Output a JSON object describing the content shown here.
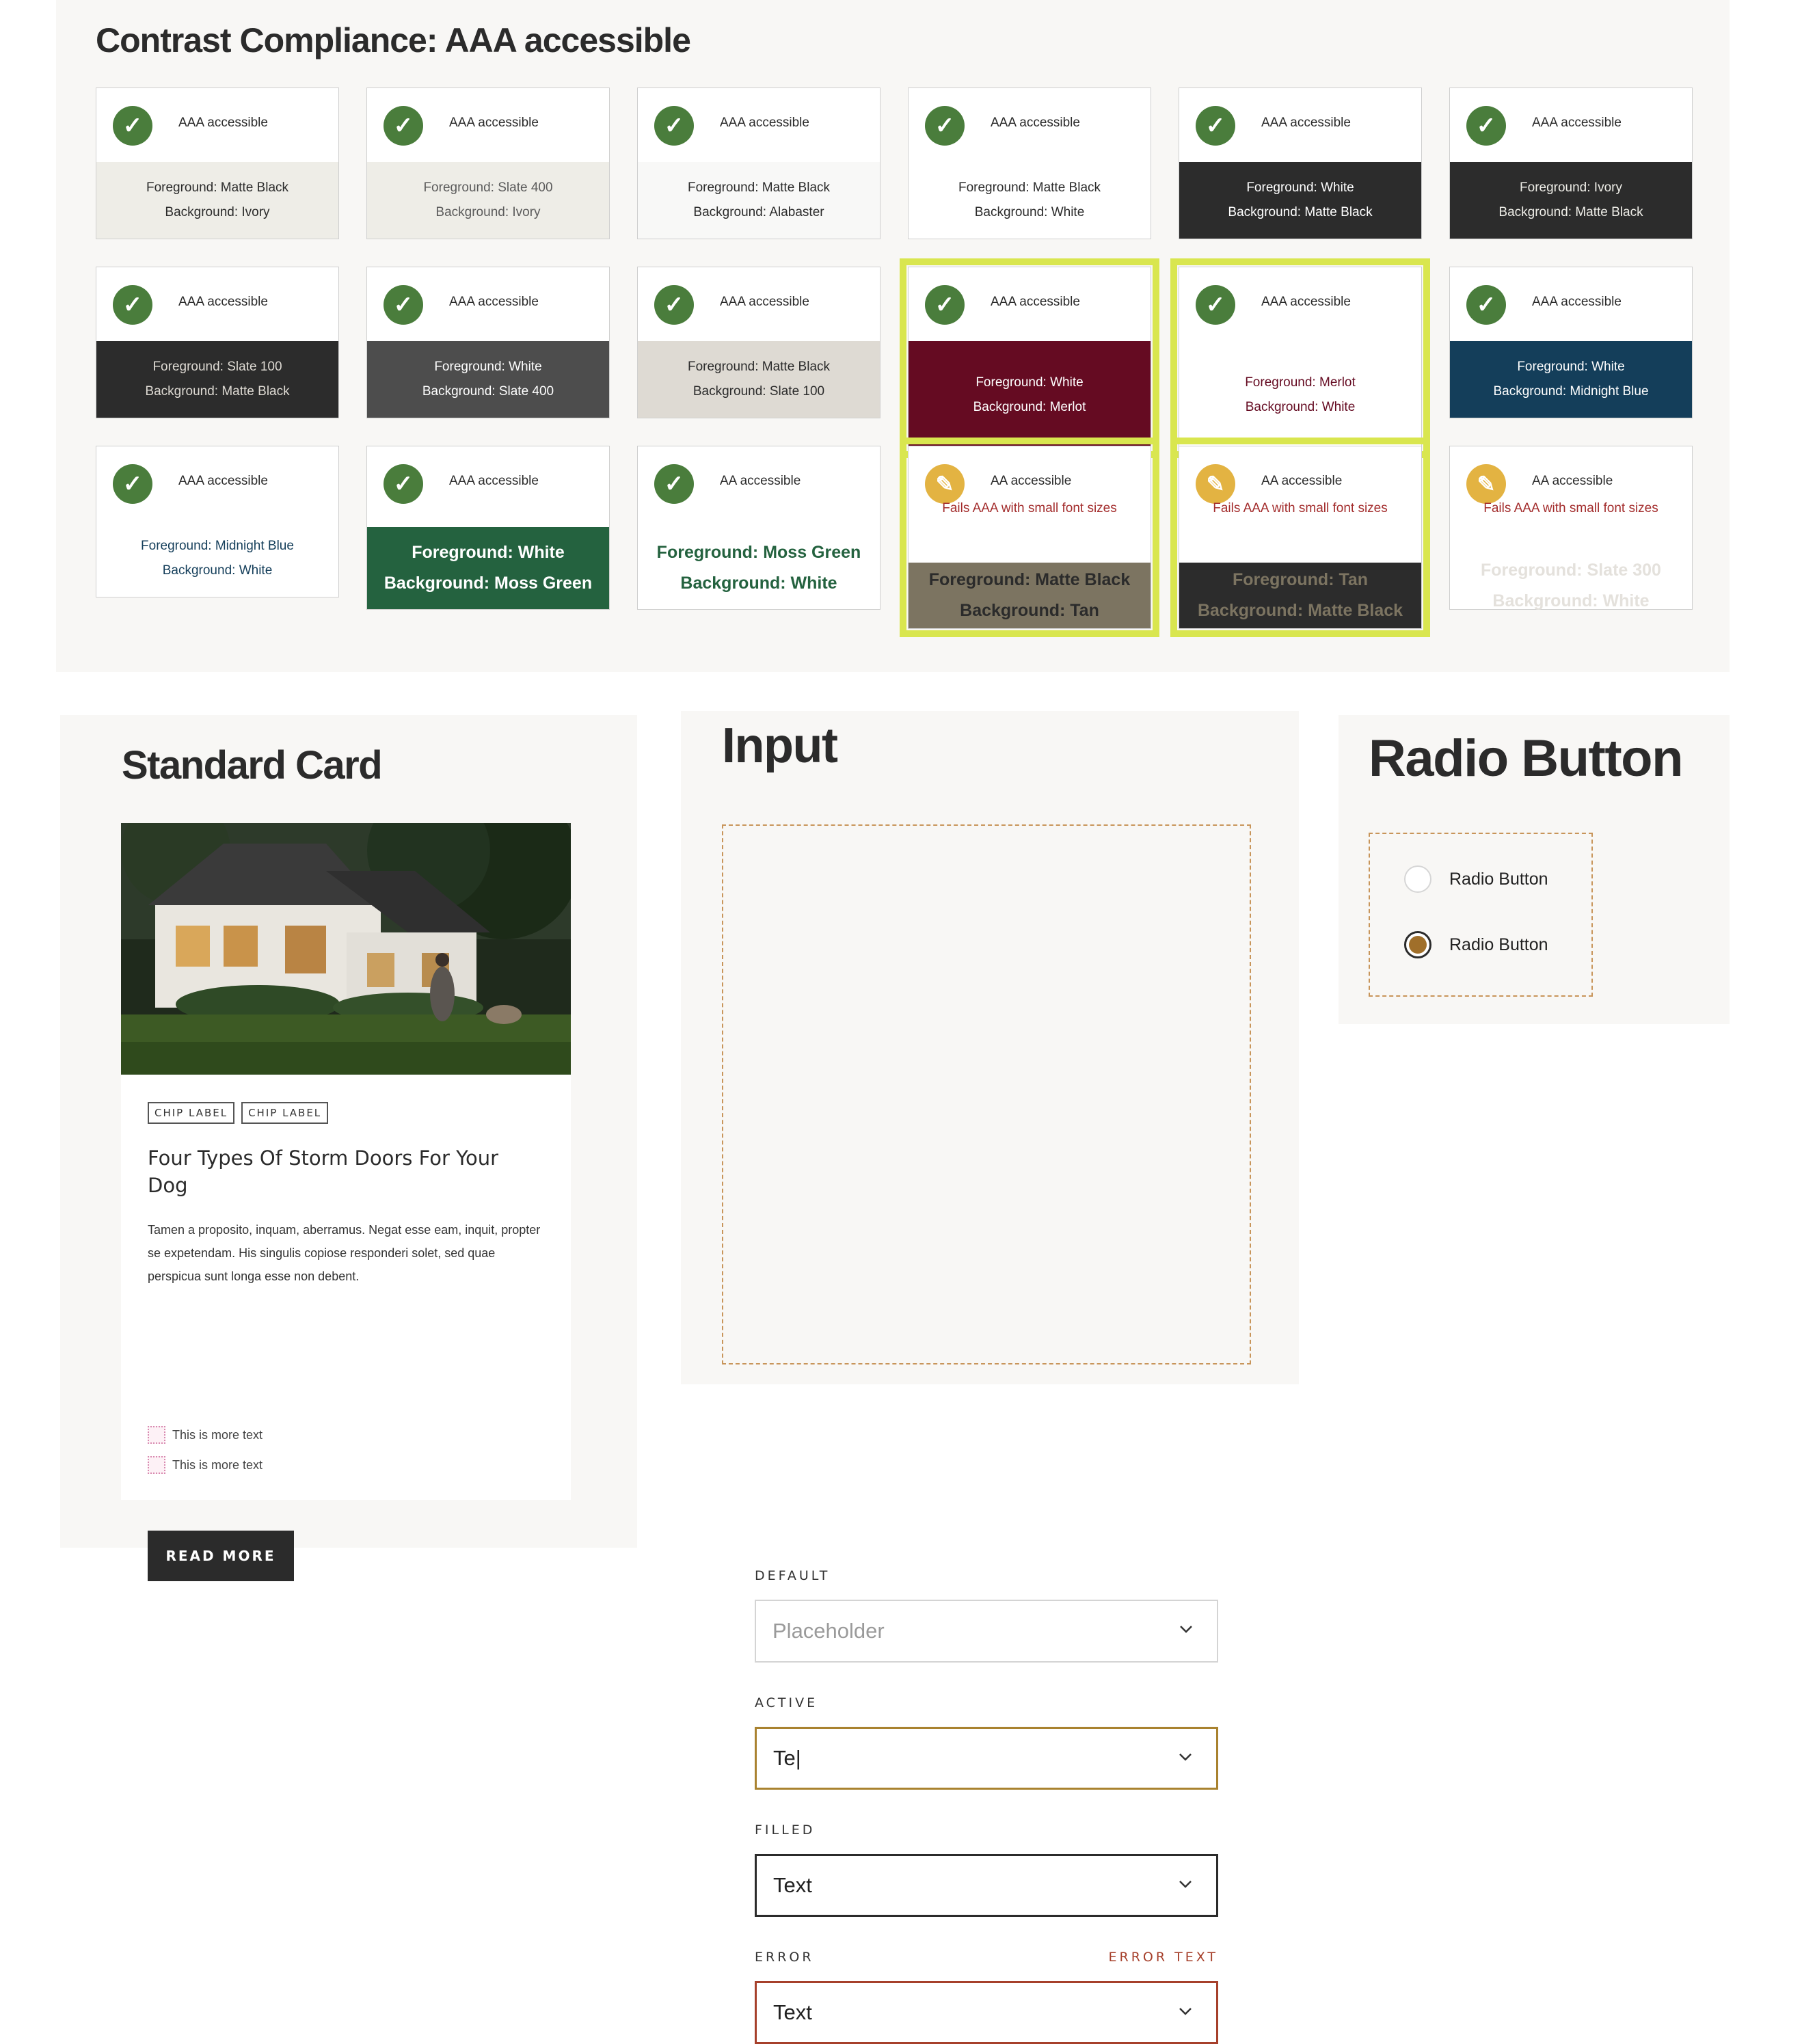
{
  "contrast": {
    "title": "Contrast Compliance: AAA accessible",
    "fails_text": "Fails AAA with small font sizes",
    "cards": [
      {
        "level": "AAA accessible",
        "status": "check-icon",
        "fg": "Foreground: Matte Black",
        "bg": "Background: Ivory",
        "fg_color": "#2b2b2b",
        "bg_color": "#eeede7",
        "strip_color": "#ffffff"
      },
      {
        "level": "AAA accessible",
        "status": "check-icon",
        "fg": "Foreground: Slate 400",
        "bg": "Background: Ivory",
        "fg_color": "#5b5b5b",
        "bg_color": "#eeede7",
        "strip_color": "#ffffff"
      },
      {
        "level": "AAA accessible",
        "status": "check-icon",
        "fg": "Foreground: Matte Black",
        "bg": "Background: Alabaster",
        "fg_color": "#2b2b2b",
        "bg_color": "#f8f8f7",
        "strip_color": "#ffffff"
      },
      {
        "level": "AAA accessible",
        "status": "check-icon",
        "fg": "Foreground: Matte Black",
        "bg": "Background: White",
        "fg_color": "#2b2b2b",
        "bg_color": "#ffffff",
        "strip_color": "#ffffff"
      },
      {
        "level": "AAA accessible",
        "status": "check-icon",
        "fg": "Foreground: White",
        "bg": "Background: Matte Black",
        "fg_color": "#ffffff",
        "bg_color": "#2c2c2c",
        "strip_color": "#ffffff"
      },
      {
        "level": "AAA accessible",
        "status": "check-icon",
        "fg": "Foreground: Ivory",
        "bg": "Background: Matte Black",
        "fg_color": "#eeede7",
        "bg_color": "#2c2c2c",
        "strip_color": "#ffffff"
      },
      {
        "level": "AAA accessible",
        "status": "check-icon",
        "fg": "Foreground: Slate 100",
        "bg": "Background: Matte Black",
        "fg_color": "#dedad3",
        "bg_color": "#2c2c2c",
        "strip_color": "#ffffff"
      },
      {
        "level": "AAA accessible",
        "status": "check-icon",
        "fg": "Foreground: White",
        "bg": "Background: Slate 400",
        "fg_color": "#ffffff",
        "bg_color": "#4d4d4d",
        "strip_color": "#ffffff"
      },
      {
        "level": "AAA accessible",
        "status": "check-icon",
        "fg": "Foreground: Matte Black",
        "bg": "Background: Slate 100",
        "fg_color": "#2b2b2b",
        "bg_color": "#dedad3",
        "strip_color": "#ffffff"
      },
      {
        "level": "AAA accessible",
        "status": "check-icon",
        "fg": "Foreground: White",
        "bg": "Background: Merlot",
        "fg_color": "#ffffff",
        "bg_color": "#650b22",
        "strip_color": "#ffffff",
        "highlight": true
      },
      {
        "level": "AAA accessible",
        "status": "check-icon",
        "fg": "Foreground: Merlot",
        "bg": "Background: White",
        "fg_color": "#650b22",
        "bg_color": "#ffffff",
        "strip_color": "#ffffff",
        "highlight": true
      },
      {
        "level": "AAA accessible",
        "status": "check-icon",
        "fg": "Foreground: White",
        "bg": "Background: Midnight Blue",
        "fg_color": "#ffffff",
        "bg_color": "#143e5a",
        "strip_color": "#ffffff"
      },
      {
        "level": "AAA accessible",
        "status": "check-icon",
        "fg": "Foreground: Midnight Blue",
        "bg": "Background: White",
        "fg_color": "#143e5a",
        "bg_color": "#ffffff",
        "strip_color": "#ffffff"
      },
      {
        "level": "AAA accessible",
        "status": "check-icon",
        "fg": "Foreground: White",
        "bg": "Background: Moss Green",
        "fg_color": "#ffffff",
        "bg_color": "#24623f",
        "strip_color": "#ffffff",
        "large": true
      },
      {
        "level": "AA accessible",
        "status": "check-icon",
        "fg": "Foreground: Moss Green",
        "bg": "Background: White",
        "fg_color": "#24623f",
        "bg_color": "#ffffff",
        "strip_color": "#ffffff",
        "large": true
      },
      {
        "level": "AA accessible",
        "status": "pencil-icon",
        "fg": "Foreground: Matte Black",
        "bg": "Background: Tan",
        "fg_color": "#2b2b2b",
        "bg_color": "#7c7461",
        "strip_color": "#ffffff",
        "large": true,
        "fails": true,
        "highlight": true
      },
      {
        "level": "AA accessible",
        "status": "pencil-icon",
        "fg": "Foreground: Tan",
        "bg": "Background: Matte Black",
        "fg_color": "#7c7461",
        "bg_color": "#2c2c2c",
        "strip_color": "#ffffff",
        "large": true,
        "fails": true,
        "highlight": true
      },
      {
        "level": "AA accessible",
        "status": "pencil-icon",
        "fg": "Foreground: Slate 300",
        "bg": "Background: White",
        "fg_color": "#e4e1dc",
        "bg_color": "#ffffff",
        "strip_color": "#ffffff",
        "large": true,
        "fails": true
      }
    ]
  },
  "card_section": {
    "title": "Standard Card",
    "chips": [
      "CHIP LABEL",
      "CHIP LABEL"
    ],
    "heading": "Four Types Of Storm Doors For Your Dog",
    "body": "Tamen a proposito, inquam, aberramus. Negat esse eam, inquit, propter se expetendam. His singulis copiose responderi solet, sed quae perspicua sunt longa esse non debent.",
    "checklist": [
      "This is more text",
      "This is more text"
    ],
    "button": "READ MORE"
  },
  "input_section": {
    "title": "Input",
    "default": {
      "label": "DEFAULT",
      "placeholder": "Placeholder"
    },
    "active": {
      "label": "ACTIVE",
      "value": "Te|"
    },
    "filled": {
      "label": "FILLED",
      "value": "Text"
    },
    "error": {
      "label": "ERROR",
      "error_text": "ERROR TEXT",
      "value": "Text"
    },
    "colors": {
      "active_border": "#a9822f",
      "error_border": "#a6402b",
      "error_text": "#a6402b"
    }
  },
  "radio_section": {
    "title": "Radio Button",
    "options": [
      {
        "label": "Radio Button",
        "checked": false
      },
      {
        "label": "Radio Button",
        "checked": true
      }
    ]
  }
}
